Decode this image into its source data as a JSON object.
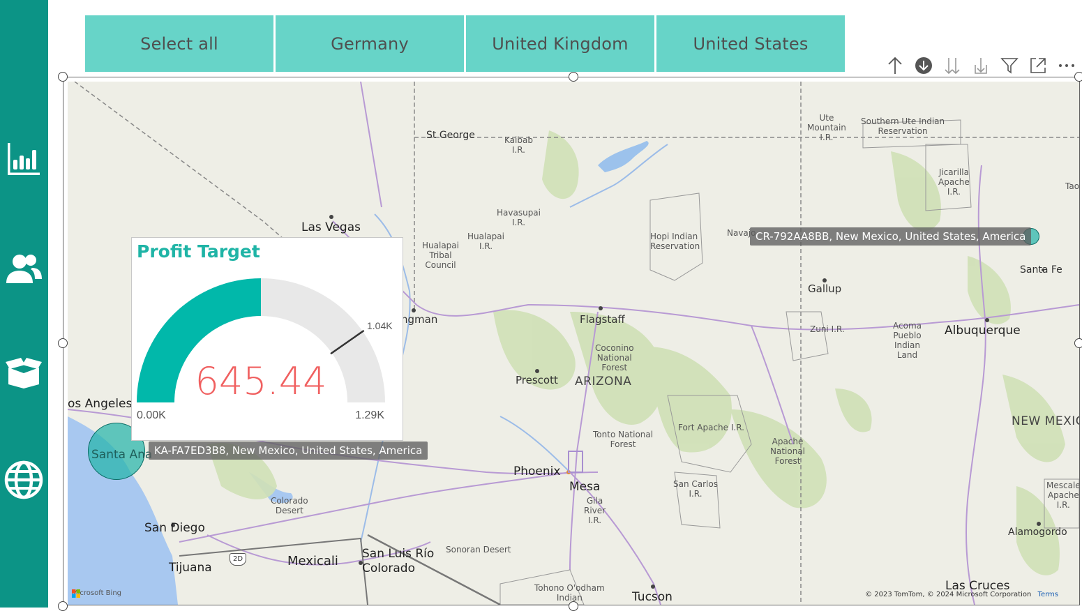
{
  "sidebar": {
    "items": [
      {
        "icon": "bar-chart-icon"
      },
      {
        "icon": "users-icon"
      },
      {
        "icon": "box-icon"
      },
      {
        "icon": "globe-icon"
      }
    ]
  },
  "slicer": {
    "options": [
      "Select all",
      "Germany",
      "United Kingdom",
      "United States"
    ]
  },
  "toolbar": {
    "icons": [
      "arrow-up-icon",
      "drill-down-circle-icon",
      "double-arrow-down-icon",
      "expand-hierarchy-icon",
      "filter-icon",
      "focus-mode-icon",
      "more-options-icon"
    ]
  },
  "gauge": {
    "title": "Profit Target",
    "value": "645.44",
    "min_label": "0.00K",
    "max_label": "1.29K",
    "target_label": "1.04K",
    "value_fraction": 0.5,
    "target_fraction": 0.806,
    "fill_color": "#01b8aa",
    "track_color": "#e8e8e8",
    "value_color": "#f06060"
  },
  "map": {
    "labels": {
      "st_george": "St George",
      "kaibab": "Kaibab\nI.R.",
      "ute_mountain": "Ute\nMountain\nI.R.",
      "southern_ute": "Southern Ute Indian\nReservation",
      "jicarilla": "Jicarilla\nApache\nI.R.",
      "tao": "Tao",
      "las_vegas": "Las Vegas",
      "havasupai": "Havasupai\nI.R.",
      "hualapai_ir": "Hualapai\nI.R.",
      "hualapai_council": "Hualapai\nTribal\nCouncil",
      "hopi": "Hopi Indian\nReservation",
      "navajo": "Navajo",
      "santa_fe": "Santa Fe",
      "gallup": "Gallup",
      "kingman": "ngman",
      "flagstaff": "Flagstaff",
      "zuni": "Zuni I.R.",
      "acoma": "Acoma\nPueblo\nIndian\nLand",
      "albuquerque": "Albuquerque",
      "coconino": "Coconino\nNational\nForest",
      "prescott": "Prescott",
      "arizona": "ARIZONA",
      "los_angeles": "os Angeles",
      "santa_ana": "Santa Ana",
      "fort_apache": "Fort Apache I.R.",
      "new_mexico": "NEW MEXICO",
      "tonto": "Tonto National\nForest",
      "apache_forest": "Apache\nNational\nForest",
      "phoenix": "Phoenix",
      "mesa": "Mesa",
      "gila": "Gila\nRiver\nI.R.",
      "san_carlos": "San Carlos\nI.R.",
      "mescalero": "Mescale\nApache\nI.R.",
      "colorado_desert": "Colorado\nDesert",
      "san_diego": "San Diego",
      "alamogordo": "Alamogordo",
      "tijuana": "Tijuana",
      "mexicali": "Mexicali",
      "san_luis": "San Luis Río\nColorado",
      "sonoran": "Sonoran Desert",
      "tohono": "Tohono O'odham\nIndian",
      "tucson": "Tucson",
      "las_cruces": "Las Cruces",
      "highway_2d": "2D"
    },
    "tooltips": [
      "CR-792AA8BB, New Mexico, United States, America",
      "KA-FA7ED3B8, New Mexico, United States, America"
    ],
    "attribution": "© 2023 TomTom, © 2024 Microsoft Corporation",
    "terms": "Terms",
    "bing": "Microsoft Bing"
  }
}
